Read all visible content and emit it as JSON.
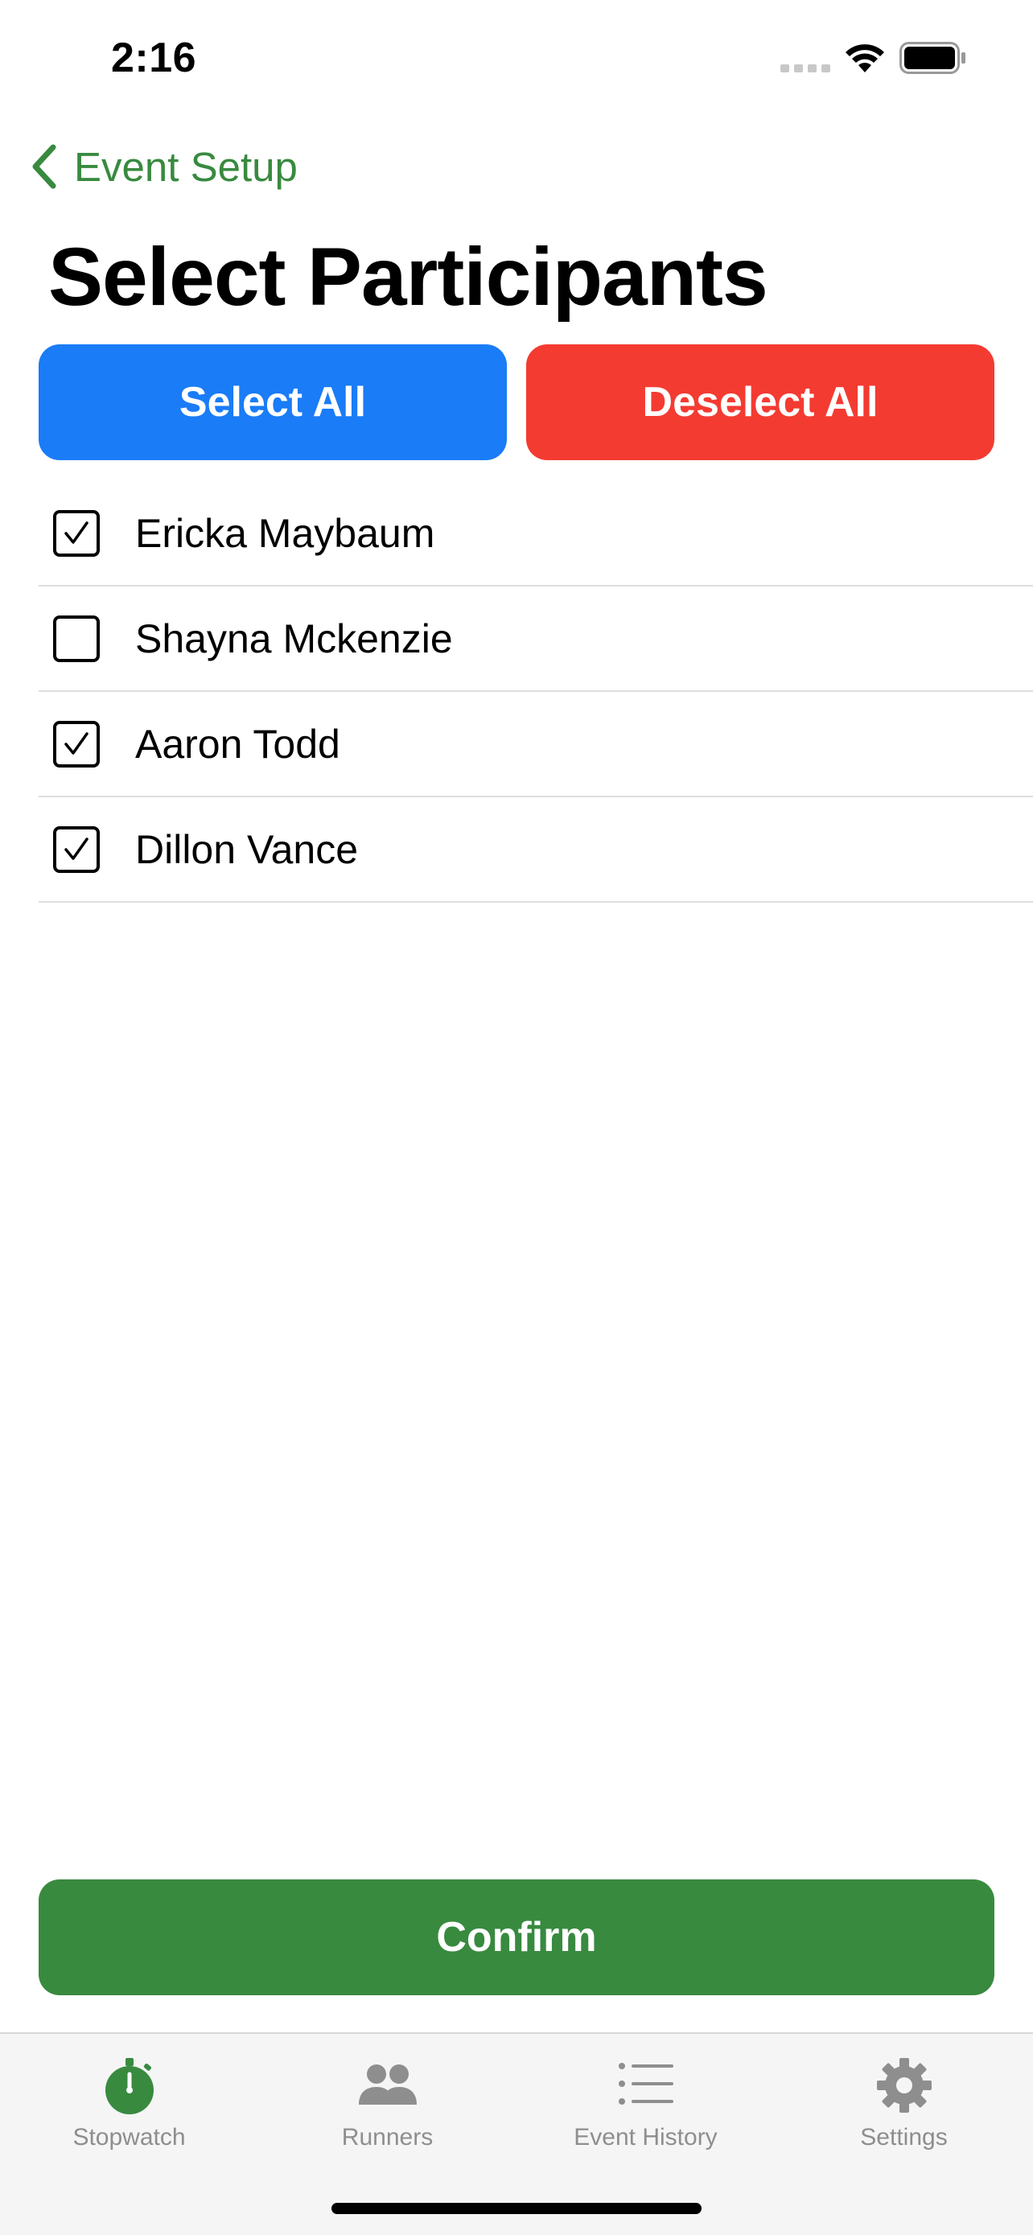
{
  "status_bar": {
    "time": "2:16"
  },
  "nav": {
    "back_label": "Event Setup"
  },
  "page": {
    "title": "Select Participants"
  },
  "actions": {
    "select_all_label": "Select All",
    "deselect_all_label": "Deselect All"
  },
  "participants": [
    {
      "name": "Ericka Maybaum",
      "checked": true
    },
    {
      "name": "Shayna Mckenzie",
      "checked": false
    },
    {
      "name": "Aaron Todd",
      "checked": true
    },
    {
      "name": "Dillon Vance",
      "checked": true
    }
  ],
  "confirm_label": "Confirm",
  "tabs": [
    {
      "label": "Stopwatch",
      "icon": "stopwatch-icon",
      "active": true
    },
    {
      "label": "Runners",
      "icon": "people-icon",
      "active": false
    },
    {
      "label": "Event History",
      "icon": "list-icon",
      "active": false
    },
    {
      "label": "Settings",
      "icon": "gear-icon",
      "active": false
    }
  ],
  "colors": {
    "accent_green": "#388a3f",
    "select_all_blue": "#1a7cf7",
    "deselect_all_red": "#f43b32",
    "tab_inactive_gray": "#8e8e8e"
  }
}
